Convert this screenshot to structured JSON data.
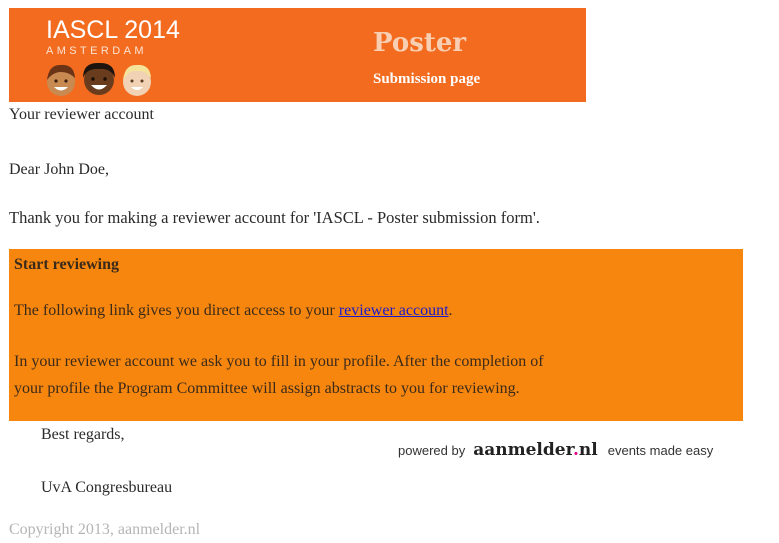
{
  "banner": {
    "logo_title": "IASCL 2014",
    "logo_subtitle": "AMSTERDAM",
    "title": "Poster",
    "subtitle": "Submission page"
  },
  "email": {
    "heading": "Your reviewer account",
    "greeting": "Dear John Doe,",
    "thanks": "Thank you for making a reviewer account for 'IASCL - Poster submission form'.",
    "box": {
      "title": "Start reviewing",
      "link_prefix": "The following link gives you direct access to your ",
      "link_text": "reviewer account",
      "link_suffix": ".",
      "info_line1": "In your reviewer account we ask you to fill in your profile. After the completion of",
      "info_line2": "your profile the Program Committee will assign abstracts to you for reviewing."
    },
    "regards": "Best regards,",
    "signature": "UvA Congresbureau"
  },
  "powered": {
    "prefix": "powered by",
    "brand_main": "aanmelder",
    "brand_dot": ".",
    "brand_tld": "nl",
    "tagline": "events made easy"
  },
  "footer": {
    "copyright": "Copyright 2013, aanmelder.nl"
  },
  "colors": {
    "banner": "#f26b1f",
    "box": "#f7860f",
    "link": "#1a1acd",
    "brand_dot": "#e5007e"
  }
}
